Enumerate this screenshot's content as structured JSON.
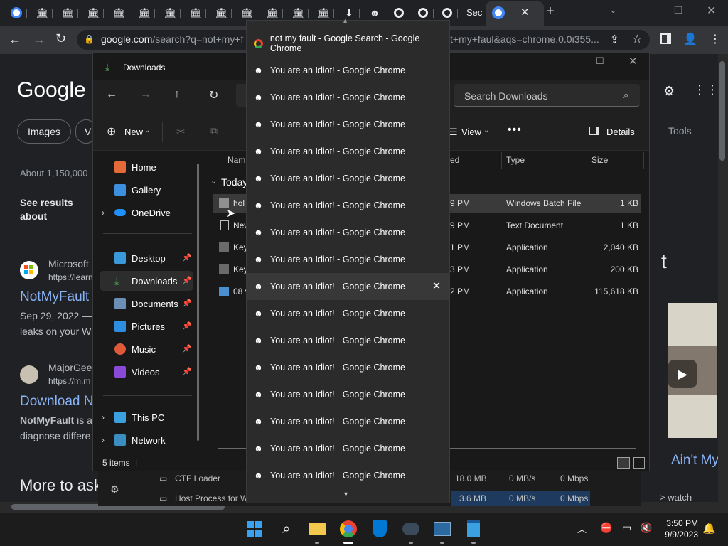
{
  "chrome": {
    "tab_text": "Sec",
    "address_host": "google.com",
    "address_path": "/search?q=not+my+f",
    "address_tail": "t+my+faul&aqs=chrome.0.0i355..."
  },
  "google": {
    "logo": "Google",
    "chips": [
      "Images",
      "V"
    ],
    "tools_label": "Tools",
    "results_count": "About 1,150,000",
    "see_results": "See results about",
    "result1_site": "Microsoft",
    "result1_url": "https://learn",
    "result1_title": "NotMyFault",
    "result1_date": "Sep 29, 2022 — N",
    "result1_snippet": "leaks on your Wi",
    "result2_site": "MajorGeek",
    "result2_url": "https://m.m",
    "result2_title": "Download N",
    "result2_snippet_b": "NotMyFault",
    "result2_snippet_a": " is a",
    "result2_snippet2": "diagnose differe",
    "more_to_ask": "More to ask",
    "right_snippet": "t",
    "right_link": "Ain't My",
    "watch": "> watch"
  },
  "explorer": {
    "title": "Downloads",
    "search_placeholder": "Search Downloads",
    "new_label": "New",
    "view_label": "View",
    "details_label": "Details",
    "nav": {
      "home": "Home",
      "gallery": "Gallery",
      "onedrive": "OneDrive",
      "desktop": "Desktop",
      "downloads": "Downloads",
      "documents": "Documents",
      "pictures": "Pictures",
      "music": "Music",
      "videos": "Videos",
      "thispc": "This PC",
      "network": "Network"
    },
    "columns": {
      "name": "Nam",
      "date": "ed",
      "type": "Type",
      "size": "Size"
    },
    "group": "Today",
    "rows": [
      {
        "name": "hol",
        "date": "9 PM",
        "type": "Windows Batch File",
        "size": "1 KB"
      },
      {
        "name": "New",
        "date": "9 PM",
        "type": "Text Document",
        "size": "1 KB"
      },
      {
        "name": "Key",
        "date": "1 PM",
        "type": "Application",
        "size": "2,040 KB"
      },
      {
        "name": "Key",
        "date": "3 PM",
        "type": "Application",
        "size": "200 KB"
      },
      {
        "name": "08 v",
        "date": "2 PM",
        "type": "Application",
        "size": "115,618 KB"
      }
    ],
    "status": "5 items"
  },
  "taskmgr": {
    "row1": {
      "name": "CTF Loader",
      "mem": "18.0 MB",
      "disk": "0 MB/s",
      "net": "0 Mbps"
    },
    "row2": {
      "name": "Host Process for W",
      "mem": "3.6 MB",
      "disk": "0 MB/s",
      "net": "0 Mbps"
    }
  },
  "popup": {
    "items": [
      "not my fault - Google Search - Google Chrome",
      "You are an Idiot! - Google Chrome",
      "You are an Idiot! - Google Chrome",
      "You are an Idiot! - Google Chrome",
      "You are an Idiot! - Google Chrome",
      "You are an Idiot! - Google Chrome",
      "You are an Idiot! - Google Chrome",
      "You are an Idiot! - Google Chrome",
      "You are an Idiot! - Google Chrome",
      "You are an Idiot! - Google Chrome",
      "You are an Idiot! - Google Chrome",
      "You are an Idiot! - Google Chrome",
      "You are an Idiot! - Google Chrome",
      "You are an Idiot! - Google Chrome",
      "You are an Idiot! - Google Chrome",
      "You are an Idiot! - Google Chrome",
      "You are an Idiot! - Google Chrome"
    ]
  },
  "taskbar": {
    "time": "3:50 PM",
    "date": "9/9/2023"
  },
  "colors": {
    "accent_blue": "#8ab4f8",
    "folder_yellow": "#f2c94c",
    "win_blue": "#0078d4"
  }
}
